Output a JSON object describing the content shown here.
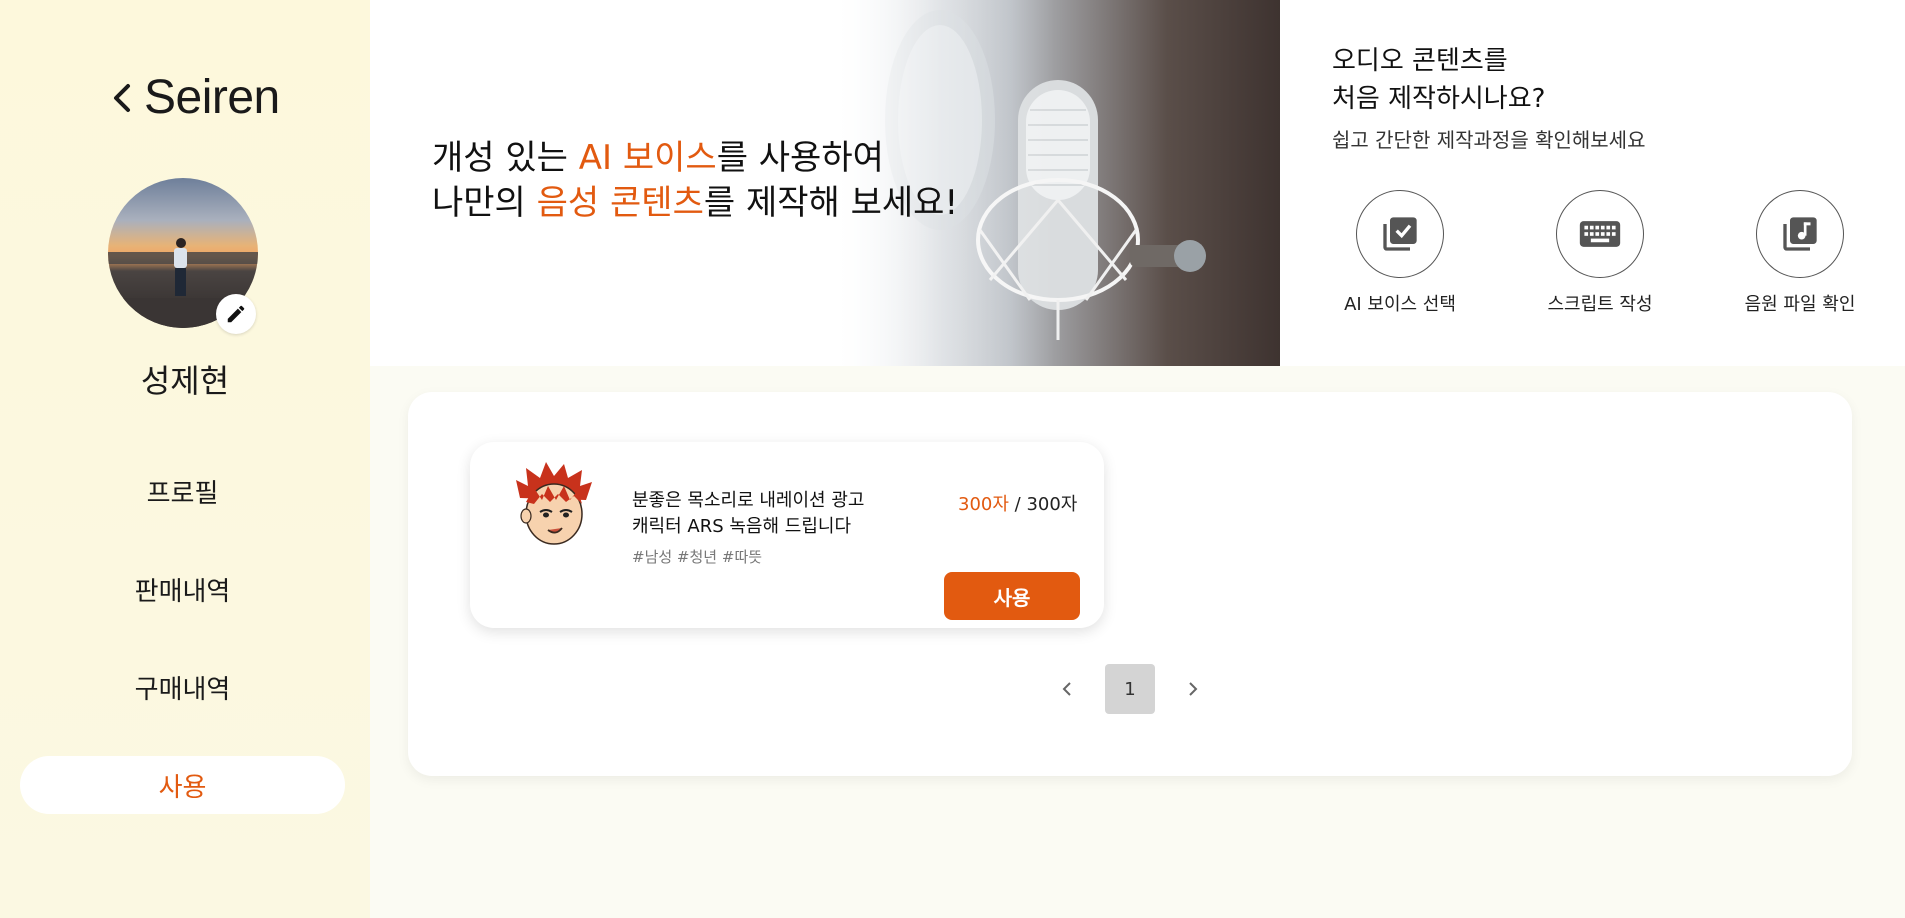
{
  "app": {
    "brand": "Seiren"
  },
  "profile": {
    "name": "성제현",
    "avatar_icon": "avatar-photo",
    "edit_icon": "pencil-icon"
  },
  "sidebar": {
    "items": [
      {
        "label": "프로필",
        "active": false
      },
      {
        "label": "판매내역",
        "active": false
      },
      {
        "label": "구매내역",
        "active": false
      },
      {
        "label": "사용",
        "active": true
      }
    ]
  },
  "hero": {
    "line1_pre": "개성 있는 ",
    "line1_hl": "AI 보이스",
    "line1_post": "를 사용하여",
    "line2_pre": "나만의 ",
    "line2_hl": "음성 콘텐츠",
    "line2_post": "를 제작해 보세요!"
  },
  "guide": {
    "title_line1": "오디오 콘텐츠를",
    "title_line2": "처음 제작하시나요?",
    "subtitle": "쉽고 간단한 제작과정을 확인해보세요",
    "steps": [
      {
        "label": "AI 보이스 선택",
        "icon": "library-check-icon"
      },
      {
        "label": "스크립트 작성",
        "icon": "keyboard-icon"
      },
      {
        "label": "음원 파일 확인",
        "icon": "library-music-icon"
      }
    ]
  },
  "voice_card": {
    "desc_line1": "분좋은 목소리로 내레이션 광고",
    "desc_line2": "캐릭터 ARS 녹음해 드립니다",
    "tags": "#남성 #청년 #따뜻",
    "used": "300자",
    "separator": " / ",
    "total": "300자",
    "button": "사용"
  },
  "pagination": {
    "current": "1"
  },
  "colors": {
    "accent": "#e25a10",
    "sidebar_bg": "#fdf8dc",
    "page_bg": "#fbfbf3"
  }
}
